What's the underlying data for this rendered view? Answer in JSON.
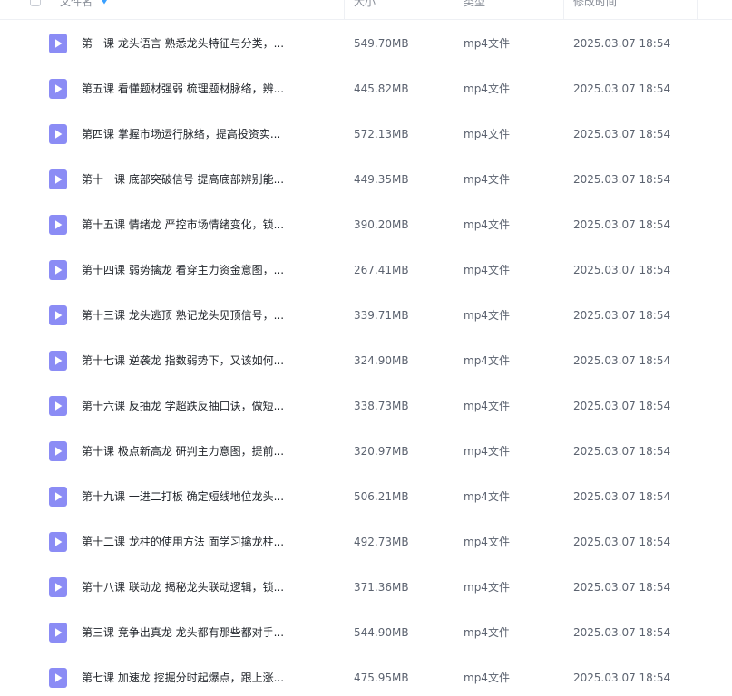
{
  "header": {
    "name_label": "文件名",
    "size_label": "大小",
    "type_label": "类型",
    "modified_label": "修改时间",
    "sort_icon": "sort-descending-icon",
    "accent_color": "#3aa0ff"
  },
  "icons": {
    "file_icon": "video-file-play-icon",
    "file_icon_color": "#8b8cf5"
  },
  "files": [
    {
      "name": "第一课 龙头语言 熟悉龙头特征与分类，...",
      "size": "549.70MB",
      "type": "mp4文件",
      "modified": "2025.03.07 18:54"
    },
    {
      "name": "第五课 看懂题材强弱 梳理题材脉络，辨...",
      "size": "445.82MB",
      "type": "mp4文件",
      "modified": "2025.03.07 18:54"
    },
    {
      "name": "第四课 掌握市场运行脉络，提高投资实...",
      "size": "572.13MB",
      "type": "mp4文件",
      "modified": "2025.03.07 18:54"
    },
    {
      "name": "第十一课 底部突破信号 提高底部辨别能...",
      "size": "449.35MB",
      "type": "mp4文件",
      "modified": "2025.03.07 18:54"
    },
    {
      "name": "第十五课 情绪龙 严控市场情绪变化，锁...",
      "size": "390.20MB",
      "type": "mp4文件",
      "modified": "2025.03.07 18:54"
    },
    {
      "name": "第十四课 弱势擒龙 看穿主力资金意图，...",
      "size": "267.41MB",
      "type": "mp4文件",
      "modified": "2025.03.07 18:54"
    },
    {
      "name": "第十三课 龙头逃顶 熟记龙头见顶信号，...",
      "size": "339.71MB",
      "type": "mp4文件",
      "modified": "2025.03.07 18:54"
    },
    {
      "name": "第十七课 逆袭龙 指数弱势下，又该如何...",
      "size": "324.90MB",
      "type": "mp4文件",
      "modified": "2025.03.07 18:54"
    },
    {
      "name": "第十六课 反抽龙 学超跌反抽口诀，做短...",
      "size": "338.73MB",
      "type": "mp4文件",
      "modified": "2025.03.07 18:54"
    },
    {
      "name": "第十课 极点新高龙 研判主力意图，提前...",
      "size": "320.97MB",
      "type": "mp4文件",
      "modified": "2025.03.07 18:54"
    },
    {
      "name": "第十九课 一进二打板 确定短线地位龙头...",
      "size": "506.21MB",
      "type": "mp4文件",
      "modified": "2025.03.07 18:54"
    },
    {
      "name": "第十二课 龙柱的使用方法 面学习擒龙柱...",
      "size": "492.73MB",
      "type": "mp4文件",
      "modified": "2025.03.07 18:54"
    },
    {
      "name": "第十八课 联动龙 揭秘龙头联动逻辑，锁...",
      "size": "371.36MB",
      "type": "mp4文件",
      "modified": "2025.03.07 18:54"
    },
    {
      "name": "第三课 竞争出真龙 龙头都有那些都对手...",
      "size": "544.90MB",
      "type": "mp4文件",
      "modified": "2025.03.07 18:54"
    },
    {
      "name": "第七课 加速龙 挖掘分时起爆点，跟上涨...",
      "size": "475.95MB",
      "type": "mp4文件",
      "modified": "2025.03.07 18:54"
    }
  ]
}
